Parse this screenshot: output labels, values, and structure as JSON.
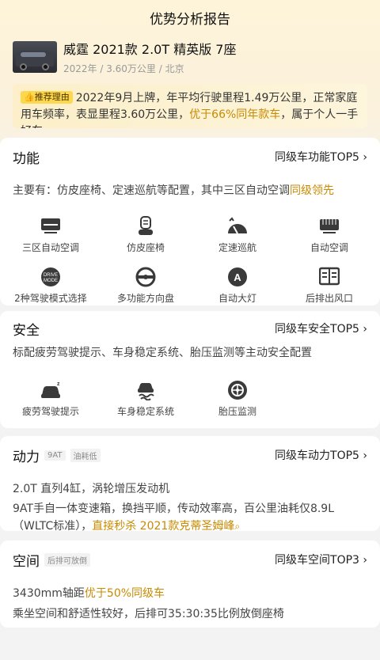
{
  "header": {
    "title": "优势分析报告"
  },
  "car": {
    "title": "威霆 2021款 2.0T 精英版 7座",
    "meta": "2022年 / 3.60万公里 / 北京"
  },
  "reason": {
    "tag": "推荐理由",
    "text_a": "2022年9月上牌，年平均行驶里程1.49万公里，正常家庭用车频率，表显里程3.60万公里，",
    "highlight": "优于66%同年款车",
    "text_b": "，属于个人一手好车"
  },
  "function": {
    "title": "功能",
    "link": "同级车功能TOP5 ›",
    "desc_a": "主要有：仿皮座椅、定速巡航等配置，其中三区自动空调",
    "desc_hl": "同级领先",
    "items": [
      {
        "label": "三区自动空调",
        "icon": "ac-zone-icon"
      },
      {
        "label": "仿皮座椅",
        "icon": "seat-icon"
      },
      {
        "label": "定速巡航",
        "icon": "cruise-icon"
      },
      {
        "label": "自动空调",
        "icon": "auto-ac-icon"
      },
      {
        "label": "2种驾驶模式选择",
        "icon": "drive-mode-icon"
      },
      {
        "label": "多功能方向盘",
        "icon": "steering-wheel-icon"
      },
      {
        "label": "自动大灯",
        "icon": "headlight-icon"
      },
      {
        "label": "后排出风口",
        "icon": "rear-vent-icon"
      }
    ],
    "drive_icon_text_a": "DRIVE",
    "drive_icon_text_b": "MODE"
  },
  "safety": {
    "title": "安全",
    "link": "同级车安全TOP5 ›",
    "desc": "标配疲劳驾驶提示、车身稳定系统、胎压监测等主动安全配置",
    "items": [
      {
        "label": "疲劳驾驶提示",
        "icon": "fatigue-icon"
      },
      {
        "label": "车身稳定系统",
        "icon": "stability-icon"
      },
      {
        "label": "胎压监测",
        "icon": "tire-pressure-icon"
      }
    ]
  },
  "power": {
    "title": "动力",
    "tags": [
      "9AT",
      "油耗低"
    ],
    "link": "同级车动力TOP5 ›",
    "line1": "2.0T 直列4缸，涡轮增压发动机",
    "line2_a": "9AT手自一体变速箱，换挡平顺，传动效率高，百公里油耗仅8.9L（WLTC标准），",
    "line2_hl": "直接秒杀 2021款克蒂圣姆峰",
    "search_glyph": "⌕"
  },
  "space": {
    "title": "空间",
    "tag": "后排可放倒",
    "link": "同级车空间TOP3 ›",
    "line1_a": "3430mm轴距",
    "line1_hl": "优于50%同级车",
    "line2": "乘坐空间和舒适性较好，后排可35:30:35比例放倒座椅"
  },
  "colors": {
    "accent": "#c98a00",
    "tag_bg": "#fdd74d",
    "icon": "#3a3a3a"
  }
}
